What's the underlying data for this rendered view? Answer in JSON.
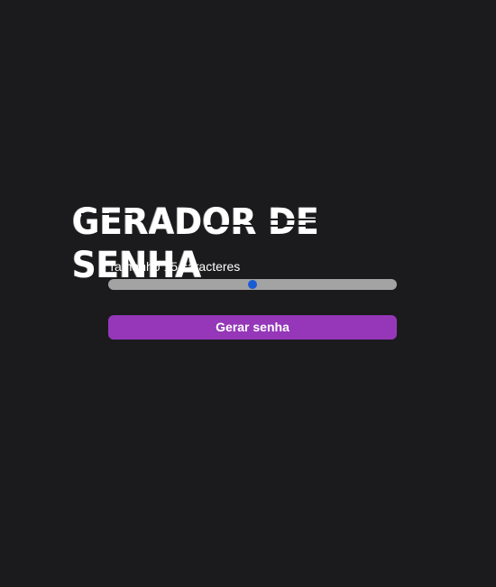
{
  "header": {
    "title": "GERADOR DE SENHA"
  },
  "length_control": {
    "label_prefix": "Tamanho",
    "value": "15",
    "label_suffix": "caracteres",
    "min": 1,
    "max": 29,
    "current": 15
  },
  "actions": {
    "generate_label": "Gerar senha"
  },
  "colors": {
    "background": "#1b1b1d",
    "accent": "#9537b8",
    "slider_track": "#a3a3a3",
    "slider_thumb": "#1a5bd6",
    "text": "#ffffff"
  }
}
